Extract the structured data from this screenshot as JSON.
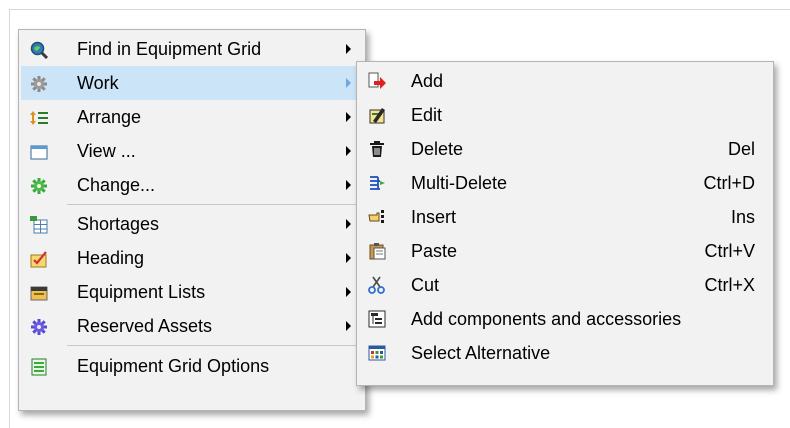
{
  "main_menu": {
    "items": [
      {
        "label": "Find in Equipment Grid",
        "icon": "magnifier-globe-icon"
      },
      {
        "label": "Work",
        "icon": "gear-icon",
        "highlighted": true
      },
      {
        "label": "Arrange",
        "icon": "arrange-list-icon"
      },
      {
        "label": "View ...",
        "icon": "window-icon"
      },
      {
        "label": "Change...",
        "icon": "green-gear-icon"
      },
      {
        "label": "Shortages",
        "icon": "shortage-grid-icon"
      },
      {
        "label": "Heading",
        "icon": "heading-check-icon"
      },
      {
        "label": "Equipment Lists",
        "icon": "folder-icon"
      },
      {
        "label": "Reserved Assets",
        "icon": "purple-gear-icon"
      },
      {
        "label": "Equipment Grid Options",
        "icon": "grid-options-icon"
      }
    ]
  },
  "work_submenu": {
    "items": [
      {
        "label": "Add",
        "shortcut": "",
        "icon": "add-arrow-icon"
      },
      {
        "label": "Edit",
        "shortcut": "",
        "icon": "edit-pencil-icon"
      },
      {
        "label": "Delete",
        "shortcut": "Del",
        "icon": "trash-icon"
      },
      {
        "label": "Multi-Delete",
        "shortcut": "Ctrl+D",
        "icon": "multi-delete-icon"
      },
      {
        "label": "Insert",
        "shortcut": "Ins",
        "icon": "insert-hand-icon"
      },
      {
        "label": "Paste",
        "shortcut": "Ctrl+V",
        "icon": "clipboard-icon"
      },
      {
        "label": "Cut",
        "shortcut": "Ctrl+X",
        "icon": "scissors-icon"
      },
      {
        "label": "Add components and accessories",
        "shortcut": "",
        "icon": "components-tree-icon"
      },
      {
        "label": "Select Alternative",
        "shortcut": "",
        "icon": "alternative-grid-icon"
      }
    ]
  },
  "colors": {
    "highlight": "#cce4f7",
    "menu_background": "#f2f2f2",
    "menu_border": "#b4b4b4"
  }
}
